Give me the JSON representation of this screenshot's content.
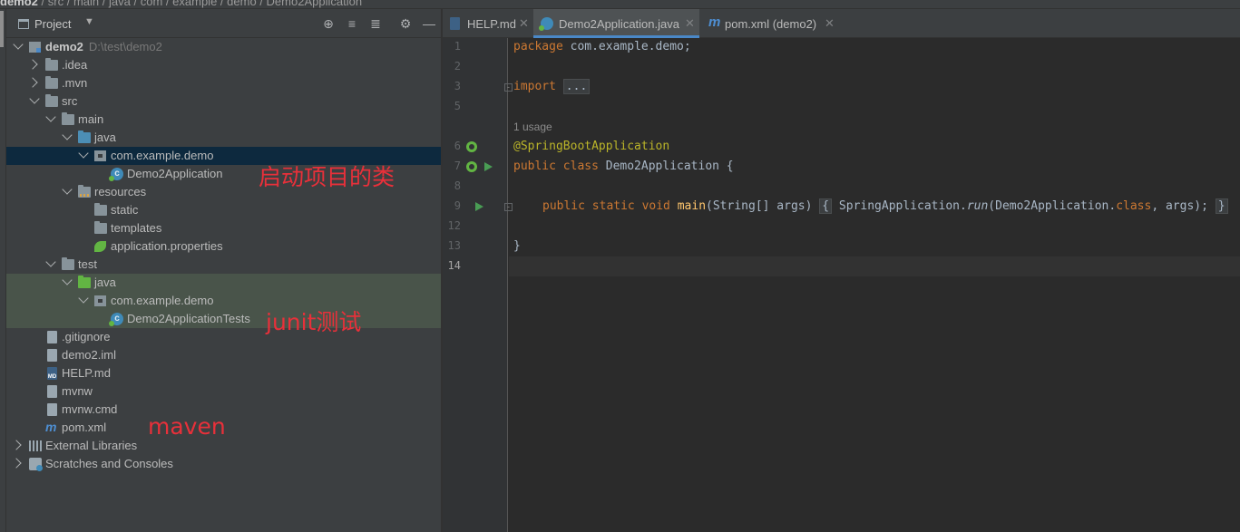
{
  "breadcrumb": {
    "items": [
      "demo2",
      "src",
      "main",
      "java",
      "com",
      "example",
      "demo",
      "Demo2Application"
    ]
  },
  "project_panel": {
    "title": "Project",
    "toolbar_icons": [
      "locate-icon",
      "expand-all-icon",
      "collapse-all-icon",
      "settings-icon",
      "hide-icon"
    ]
  },
  "tree": [
    {
      "label": "demo2",
      "path": "D:\\test\\demo2",
      "icon": "module-icon",
      "expanded": true
    },
    {
      "label": ".idea",
      "icon": "folder-icon",
      "expanded": false
    },
    {
      "label": ".mvn",
      "icon": "folder-icon",
      "expanded": false
    },
    {
      "label": "src",
      "icon": "folder-icon",
      "expanded": true
    },
    {
      "label": "main",
      "icon": "folder-icon",
      "expanded": true
    },
    {
      "label": "java",
      "icon": "source-folder-icon",
      "expanded": true
    },
    {
      "label": "com.example.demo",
      "icon": "package-icon",
      "expanded": true,
      "selected": true
    },
    {
      "label": "Demo2Application",
      "icon": "spring-class-icon"
    },
    {
      "label": "resources",
      "icon": "resources-folder-icon",
      "expanded": true
    },
    {
      "label": "static",
      "icon": "folder-icon"
    },
    {
      "label": "templates",
      "icon": "folder-icon"
    },
    {
      "label": "application.properties",
      "icon": "spring-properties-icon"
    },
    {
      "label": "test",
      "icon": "folder-icon",
      "expanded": true
    },
    {
      "label": "java",
      "icon": "test-folder-icon",
      "expanded": true
    },
    {
      "label": "com.example.demo",
      "icon": "package-icon",
      "expanded": true
    },
    {
      "label": "Demo2ApplicationTests",
      "icon": "spring-class-icon"
    },
    {
      "label": ".gitignore",
      "icon": "file-icon"
    },
    {
      "label": "demo2.iml",
      "icon": "iml-file-icon"
    },
    {
      "label": "HELP.md",
      "icon": "markdown-file-icon"
    },
    {
      "label": "mvnw",
      "icon": "file-icon"
    },
    {
      "label": "mvnw.cmd",
      "icon": "file-icon"
    },
    {
      "label": "pom.xml",
      "icon": "maven-icon"
    },
    {
      "label": "External Libraries",
      "icon": "libraries-icon",
      "expanded": false
    },
    {
      "label": "Scratches and Consoles",
      "icon": "scratches-icon",
      "expanded": false
    }
  ],
  "annotations": {
    "startup_class": "启动项目的类",
    "junit": "junit测试",
    "maven": "maven"
  },
  "tabs": [
    {
      "label": "HELP.md",
      "icon": "markdown-file-icon",
      "active": false
    },
    {
      "label": "Demo2Application.java",
      "icon": "spring-class-icon",
      "active": true
    },
    {
      "label": "pom.xml (demo2)",
      "icon": "maven-icon",
      "active": false
    }
  ],
  "editor": {
    "line_numbers": [
      "1",
      "2",
      "3",
      "5",
      "6",
      "7",
      "8",
      "9",
      "12",
      "13",
      "14"
    ],
    "current_line": "14",
    "usage_hint": "1 usage",
    "code": {
      "l1_kw": "package",
      "l1_rest": " com.example.demo;",
      "l3_kw": "import",
      "l3_fold": "...",
      "l6_ann": "@SpringBootApplication",
      "l7_kw": "public class",
      "l7_rest": " Demo2Application {",
      "l9_kw": "public static void",
      "l9_fn": "main",
      "l9_args": "(String[] args)",
      "l9_open": "{",
      "l9_call": " SpringApplication.",
      "l9_run": "run",
      "l9_tail1": "(Demo2Application.",
      "l9_class": "class",
      "l9_tail2": ", args);",
      "l9_close": "}",
      "l13": "}"
    }
  },
  "colors": {
    "keyword": "#cc7832",
    "annotation": "#bbb529",
    "method": "#ffc66d",
    "text": "#a9b7c6",
    "annotation_red": "#e8303a",
    "selection": "#0d293e",
    "test_highlight": "#49544a"
  }
}
